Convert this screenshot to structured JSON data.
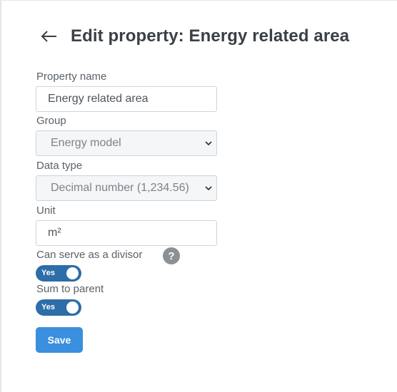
{
  "header": {
    "back_icon": "arrow-left-icon",
    "title": "Edit property: Energy related area"
  },
  "form": {
    "property_name": {
      "label": "Property name",
      "value": "Energy related area"
    },
    "group": {
      "label": "Group",
      "value": "Energy model",
      "disabled": true,
      "icon": "chevron-down-icon"
    },
    "data_type": {
      "label": "Data type",
      "value": "Decimal number (1,234.56)",
      "disabled": true,
      "icon": "chevron-down-icon"
    },
    "unit": {
      "label": "Unit",
      "value": "m²"
    },
    "divisor": {
      "label": "Can serve as a divisor",
      "help": "?",
      "toggle_label": "Yes",
      "on": true
    },
    "sum_to_parent": {
      "label": "Sum to parent",
      "toggle_label": "Yes",
      "on": true
    }
  },
  "actions": {
    "save_label": "Save"
  },
  "colors": {
    "toggle_on": "#2d6da8",
    "save_button": "#3a8fdf",
    "title": "#3b4046"
  }
}
